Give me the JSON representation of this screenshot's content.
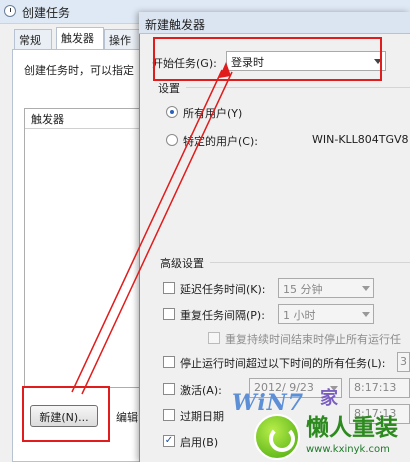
{
  "bg_window": {
    "title": "创建任务",
    "tabs": [
      "常规",
      "触发器",
      "操作"
    ],
    "description": "创建任务时，可以指定",
    "list_header": "触发器",
    "new_button": "新建(N)...",
    "edit_button": "编辑"
  },
  "dialog": {
    "title": "新建触发器",
    "start_task_label": "开始任务(G):",
    "start_task_value": "登录时",
    "settings_heading": "设置",
    "radio_all_users": "所有用户(Y)",
    "radio_specific_user": "特定的用户(C):",
    "specific_user_value": "WIN-KLL804TGV8",
    "advanced_heading": "高级设置",
    "delay_label": "延迟任务时间(K):",
    "delay_value": "15 分钟",
    "repeat_label": "重复任务间隔(P):",
    "repeat_value": "1 小时",
    "stop_repeat_label": "重复持续时间结束时停止所有运行任",
    "stop_longer_label": "停止运行时间超过以下时间的所有任务(L):",
    "stop_longer_value": "3",
    "activate_label": "激活(A):",
    "activate_date": "2012/ 9/23",
    "activate_time": "8:17:13",
    "expire_label": "过期日期",
    "expire_time": "8:17:13",
    "enabled_label": "启用(B)"
  },
  "watermark": {
    "brand": "WiN7",
    "home": "家",
    "name": "懒人重装",
    "url": "www.kxinyk.com"
  },
  "colors": {
    "highlight_red": "#e01c1c",
    "title_bar": "#dbe5f2"
  }
}
